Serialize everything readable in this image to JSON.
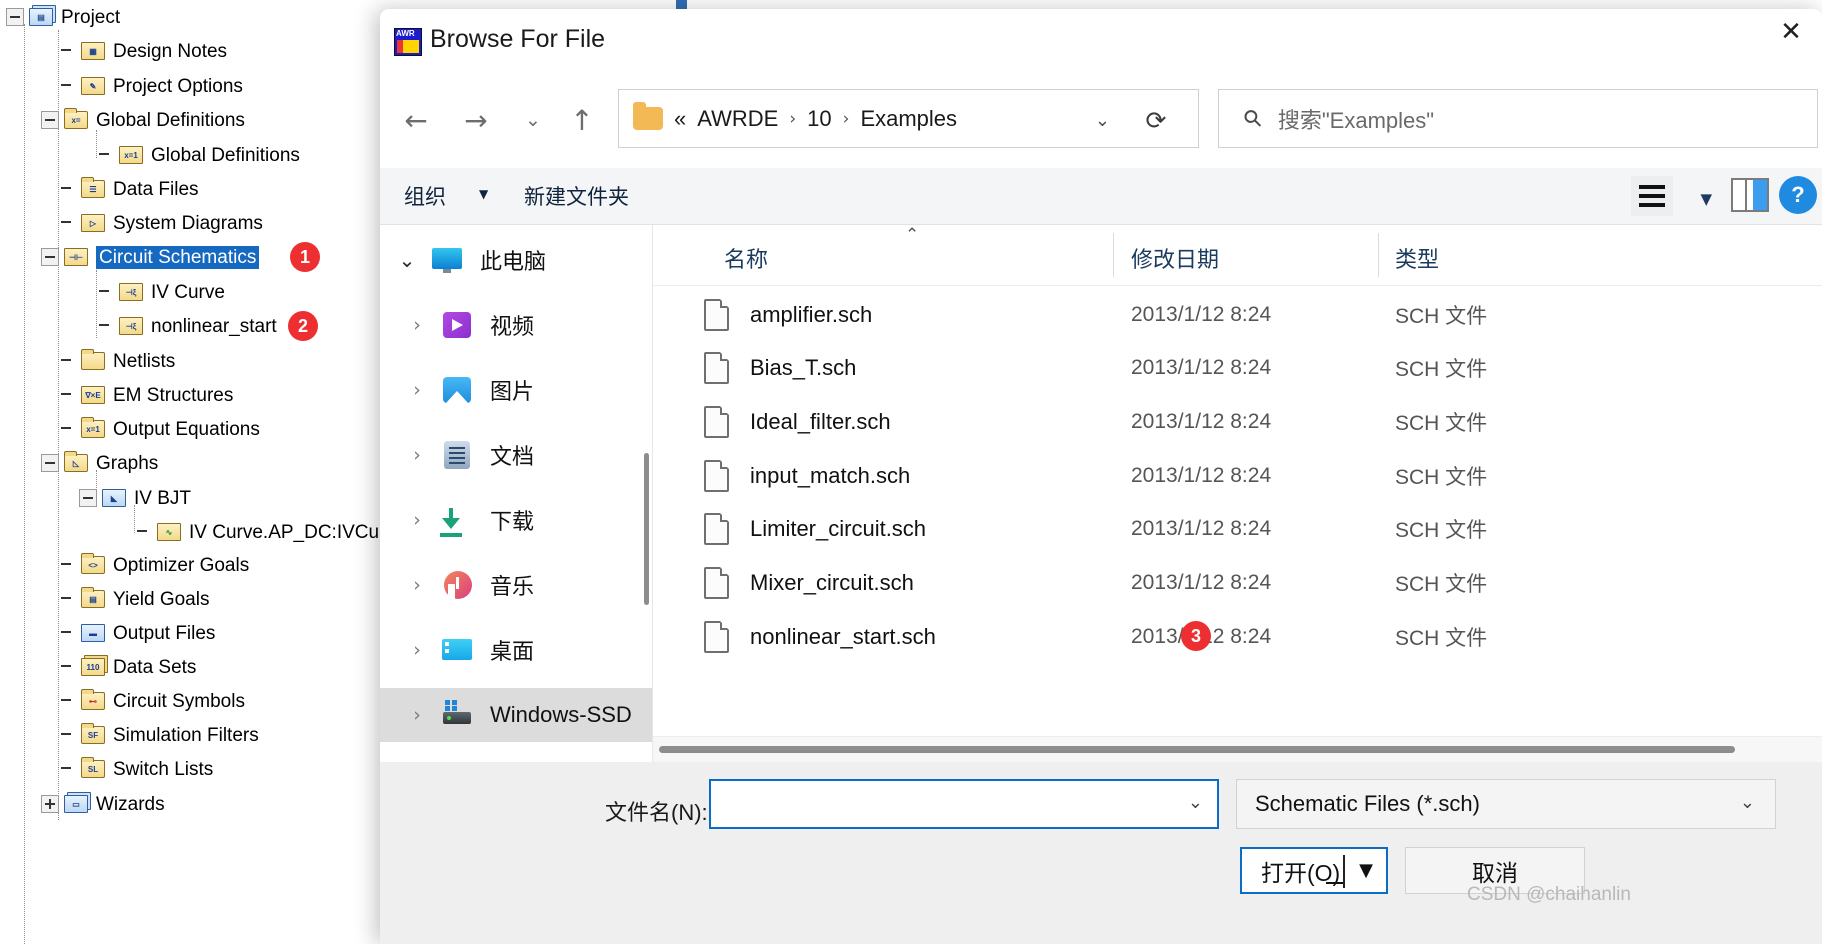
{
  "project_tree": {
    "root_label": "Project",
    "items": [
      {
        "label": "Design Notes",
        "icon": "design-notes-icon"
      },
      {
        "label": "Project Options",
        "icon": "project-options-icon"
      },
      {
        "label": "Global Definitions",
        "icon": "global-definitions-folder-icon"
      },
      {
        "label": "Global Definitions",
        "icon": "equation-icon"
      },
      {
        "label": "Data Files",
        "icon": "data-files-folder-icon"
      },
      {
        "label": "System Diagrams",
        "icon": "system-diagrams-icon"
      },
      {
        "label": "Circuit Schematics",
        "icon": "circuit-schematics-icon"
      },
      {
        "label": "IV Curve",
        "icon": "schematic-icon"
      },
      {
        "label": "nonlinear_start",
        "icon": "schematic-icon"
      },
      {
        "label": "Netlists",
        "icon": "netlists-folder-icon"
      },
      {
        "label": "EM Structures",
        "icon": "em-structures-icon"
      },
      {
        "label": "Output Equations",
        "icon": "output-equations-icon"
      },
      {
        "label": "Graphs",
        "icon": "graphs-folder-icon"
      },
      {
        "label": "IV BJT",
        "icon": "graph-icon"
      },
      {
        "label": "IV Curve.AP_DC:IVCu",
        "icon": "measurement-icon"
      },
      {
        "label": "Optimizer Goals",
        "icon": "optimizer-goals-icon"
      },
      {
        "label": "Yield Goals",
        "icon": "yield-goals-icon"
      },
      {
        "label": "Output Files",
        "icon": "output-files-icon"
      },
      {
        "label": "Data Sets",
        "icon": "data-sets-icon"
      },
      {
        "label": "Circuit Symbols",
        "icon": "circuit-symbols-icon"
      },
      {
        "label": "Simulation Filters",
        "icon": "simulation-filters-icon"
      },
      {
        "label": "Switch Lists",
        "icon": "switch-lists-icon"
      },
      {
        "label": "Wizards",
        "icon": "wizards-icon"
      }
    ],
    "selected_label": "Circuit Schematics"
  },
  "annotations": [
    {
      "number": "1",
      "target": "circuit-schematics"
    },
    {
      "number": "2",
      "target": "nonlinear_start"
    },
    {
      "number": "3",
      "target": "nonlinear_start.sch"
    }
  ],
  "dialog": {
    "title": "Browse For File",
    "close_label": "✕",
    "nav": {
      "back_label": "←",
      "forward_label": "→",
      "recent_label": "⌄",
      "up_label": "↑",
      "breadcrumbs": [
        "«",
        "AWRDE",
        "10",
        "Examples"
      ],
      "separator": "›",
      "dropdown_label": "⌄",
      "refresh_label": "⟳"
    },
    "search": {
      "placeholder": "搜索\"Examples\"",
      "icon_label": "⚲"
    },
    "commandbar": {
      "organize_label": "组织",
      "organize_caret": "▼",
      "new_folder_label": "新建文件夹",
      "view_caret": "▼",
      "help_label": "?"
    },
    "nav_pane": {
      "items": [
        {
          "label": "此电脑",
          "chevron": "⌄",
          "icon": "this-pc-icon",
          "selected": false
        },
        {
          "label": "视频",
          "chevron": "›",
          "icon": "videos-icon",
          "selected": false
        },
        {
          "label": "图片",
          "chevron": "›",
          "icon": "pictures-icon",
          "selected": false
        },
        {
          "label": "文档",
          "chevron": "›",
          "icon": "documents-icon",
          "selected": false
        },
        {
          "label": "下载",
          "chevron": "›",
          "icon": "downloads-icon",
          "selected": false
        },
        {
          "label": "音乐",
          "chevron": "›",
          "icon": "music-icon",
          "selected": false
        },
        {
          "label": "桌面",
          "chevron": "›",
          "icon": "desktop-icon",
          "selected": false
        },
        {
          "label": "Windows-SSD",
          "chevron": "›",
          "icon": "drive-icon",
          "selected": true
        }
      ]
    },
    "file_list": {
      "columns": [
        "名称",
        "修改日期",
        "类型"
      ],
      "sort_indicator": "⌃",
      "rows": [
        {
          "name": "amplifier.sch",
          "date": "2013/1/12 8:24",
          "type": "SCH 文件"
        },
        {
          "name": "Bias_T.sch",
          "date": "2013/1/12 8:24",
          "type": "SCH 文件"
        },
        {
          "name": "Ideal_filter.sch",
          "date": "2013/1/12 8:24",
          "type": "SCH 文件"
        },
        {
          "name": "input_match.sch",
          "date": "2013/1/12 8:24",
          "type": "SCH 文件"
        },
        {
          "name": "Limiter_circuit.sch",
          "date": "2013/1/12 8:24",
          "type": "SCH 文件"
        },
        {
          "name": "Mixer_circuit.sch",
          "date": "2013/1/12 8:24",
          "type": "SCH 文件"
        },
        {
          "name": "nonlinear_start.sch",
          "date": "2013/1/12 8:24",
          "type": "SCH 文件"
        }
      ]
    },
    "footer": {
      "filename_label": "文件名(N):",
      "filename_value": "",
      "filename_caret": "⌄",
      "filetype_value": "Schematic Files (*.sch)",
      "filetype_caret": "⌄",
      "open_label": "打开(O)",
      "open_caret": "▼",
      "cancel_label": "取消"
    }
  },
  "watermark": "CSDN @chaihanlin",
  "colors": {
    "selection_blue": "#1669c1",
    "badge_red": "#ed2f31",
    "accent_blue": "#0a6cc4",
    "nav_selected_gray": "#dcdcdc"
  }
}
